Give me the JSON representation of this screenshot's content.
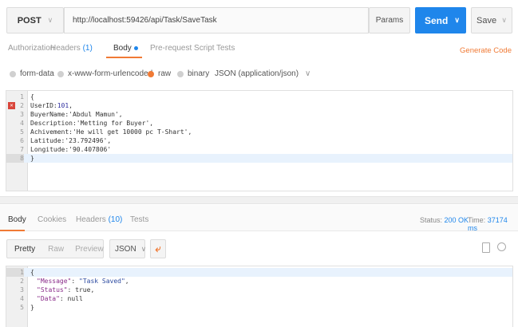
{
  "request": {
    "method": "POST",
    "url": "http://localhost:59426/api/Task/SaveTask",
    "params_label": "Params",
    "send_label": "Send",
    "save_label": "Save"
  },
  "request_tabs": [
    {
      "label": "Authorization"
    },
    {
      "label": "Headers",
      "count": "(1)"
    },
    {
      "label": "Body"
    },
    {
      "label": "Pre-request Script"
    },
    {
      "label": "Tests"
    }
  ],
  "generate_code": "Generate Code",
  "body_types": {
    "form_data": "form-data",
    "urlencoded": "x-www-form-urlencoded",
    "raw": "raw",
    "binary": "binary",
    "content_type": "JSON (application/json)"
  },
  "request_body_lines": [
    {
      "n": "1",
      "t": "{"
    },
    {
      "n": "2",
      "k": "UserID:",
      "v": "101",
      "e": ","
    },
    {
      "n": "3",
      "t": "BuyerName:'Abdul Mamun',"
    },
    {
      "n": "4",
      "t": "Description:'Metting for Buyer',"
    },
    {
      "n": "5",
      "t": "Achivement:'He will get 10000 pc T-Shart',"
    },
    {
      "n": "6",
      "t": "Latitude:'23.792496',"
    },
    {
      "n": "7",
      "t": "Longitude:'90.407806'"
    },
    {
      "n": "8",
      "t": "}"
    }
  ],
  "response_tabs": [
    {
      "label": "Body"
    },
    {
      "label": "Cookies"
    },
    {
      "label": "Headers",
      "count": "(10)"
    },
    {
      "label": "Tests"
    }
  ],
  "status": {
    "label": "Status:",
    "value": "200 OK",
    "time_label": "Time:",
    "time_value": "37174 ms"
  },
  "view_modes": [
    "Pretty",
    "Raw",
    "Preview"
  ],
  "format": "JSON",
  "response_lines": [
    {
      "n": "1",
      "t": "{"
    },
    {
      "n": "2",
      "k": "\"Message\"",
      "s": ": ",
      "v": "\"Task Saved\"",
      "e": ","
    },
    {
      "n": "3",
      "k": "\"Status\"",
      "s": ": ",
      "v": "true",
      "e": ","
    },
    {
      "n": "4",
      "k": "\"Data\"",
      "s": ": ",
      "v": "null",
      "e": ""
    },
    {
      "n": "5",
      "t": "}"
    }
  ],
  "colors": {
    "accent": "#f07a35",
    "send": "#1f86eb"
  }
}
